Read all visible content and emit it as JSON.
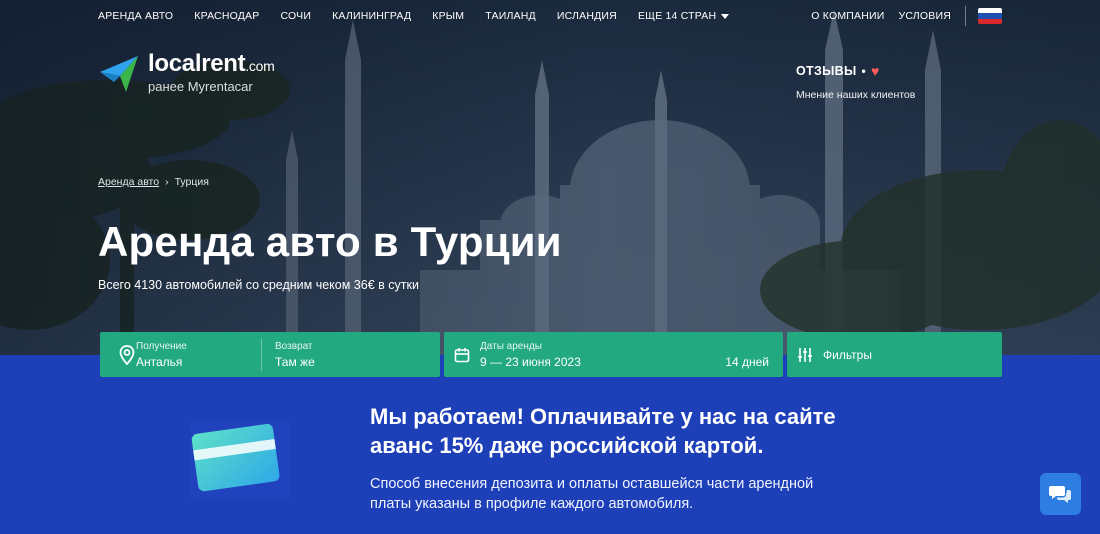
{
  "nav": {
    "items": [
      "АРЕНДА АВТО",
      "КРАСНОДАР",
      "СОЧИ",
      "КАЛИНИНГРАД",
      "КРЫМ",
      "ТАИЛАНД",
      "ИСЛАНДИЯ"
    ],
    "more": "ЕЩЕ 14 СТРАН",
    "about": "О КОМПАНИИ",
    "terms": "УСЛОВИЯ"
  },
  "logo": {
    "name": "localrent",
    "tld": ".com",
    "formerly": "ранее Myrentacar"
  },
  "reviews": {
    "title": "ОТЗЫВЫ",
    "dot": "•",
    "heart": "♥",
    "subtitle": "Мнение наших клиентов"
  },
  "breadcrumb": {
    "home": "Аренда авто",
    "separator": "›",
    "current": "Турция"
  },
  "hero": {
    "title": "Аренда авто в Турции",
    "subtitle": "Всего 4130 автомобилей со средним чеком 36€ в сутки"
  },
  "search": {
    "pickup_label": "Получение",
    "pickup_value": "Анталья",
    "return_label": "Возврат",
    "return_value": "Там же",
    "dates_label": "Даты аренды",
    "dates_value": "9 — 23 июня 2023",
    "days": "14 дней",
    "filters": "Фильтры"
  },
  "promo": {
    "title_line1": "Мы работаем! Оплачивайте у нас на сайте",
    "title_line2": "аванс 15% даже российской картой.",
    "text_line1": "Способ внесения депозита и оплаты оставшейся части арендной",
    "text_line2": "платы указаны в профиле каждого автомобиля."
  },
  "colors": {
    "accent_green": "#22a97f",
    "promo_blue": "#1d3fb8",
    "chat_blue": "#2e7de3"
  }
}
